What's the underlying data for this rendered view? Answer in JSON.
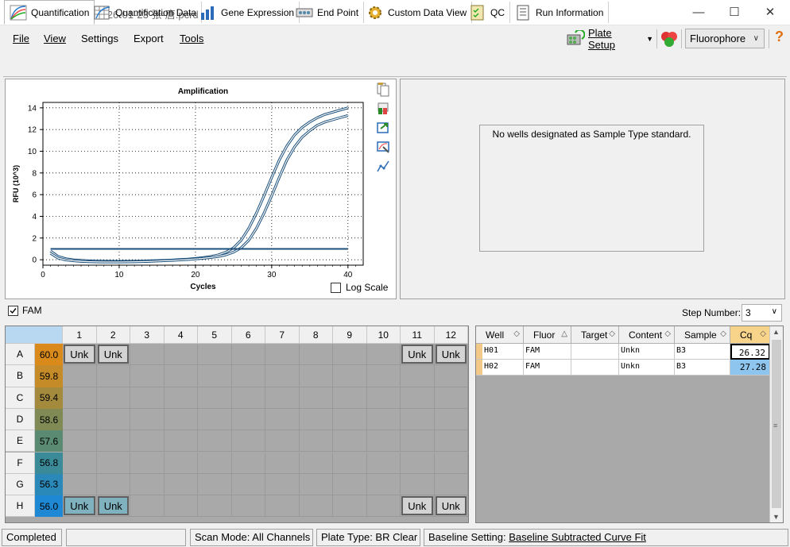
{
  "window": {
    "title": "Data Analysis - 2026-01-23 张-唐.pcrd"
  },
  "menu": {
    "file": "File",
    "view": "View",
    "settings": "Settings",
    "export": "Export",
    "tools": "Tools",
    "plate_setup": "Plate Setup",
    "fluorophore": "Fluorophore"
  },
  "tabs": [
    "Quantification",
    "Quantification Data",
    "Gene Expression",
    "End Point",
    "Custom Data View",
    "QC",
    "Run Information"
  ],
  "chart_data": {
    "type": "line",
    "title": "Amplification",
    "xlabel": "Cycles",
    "ylabel": "RFU (10^3)",
    "xlim": [
      0,
      42
    ],
    "ylim": [
      -0.5,
      14.5
    ],
    "xticks": [
      0,
      10,
      20,
      30,
      40
    ],
    "yticks": [
      0,
      2,
      4,
      6,
      8,
      10,
      12,
      14
    ],
    "grid": true,
    "threshold": 1.0,
    "series": [
      {
        "x": [
          1,
          2,
          3,
          4,
          5,
          6,
          7,
          8,
          9,
          10,
          11,
          12,
          13,
          14,
          15,
          16,
          17,
          18,
          19,
          20,
          21,
          22,
          23,
          24,
          25,
          26,
          27,
          28,
          29,
          30,
          31,
          32,
          33,
          34,
          35,
          36,
          37,
          38,
          39,
          40
        ],
        "y": [
          0.8,
          0.3,
          0.1,
          0.0,
          -0.05,
          -0.1,
          -0.12,
          -0.13,
          -0.14,
          -0.14,
          -0.14,
          -0.13,
          -0.12,
          -0.1,
          -0.08,
          -0.05,
          -0.02,
          0.02,
          0.06,
          0.12,
          0.2,
          0.3,
          0.45,
          0.7,
          1.1,
          1.8,
          2.9,
          4.3,
          5.9,
          7.6,
          9.2,
          10.5,
          11.5,
          12.2,
          12.7,
          13.1,
          13.4,
          13.6,
          13.8,
          14.0
        ]
      },
      {
        "x": [
          1,
          2,
          3,
          4,
          5,
          6,
          7,
          8,
          9,
          10,
          11,
          12,
          13,
          14,
          15,
          16,
          17,
          18,
          19,
          20,
          21,
          22,
          23,
          24,
          25,
          26,
          27,
          28,
          29,
          30,
          31,
          32,
          33,
          34,
          35,
          36,
          37,
          38,
          39,
          40
        ],
        "y": [
          0.6,
          0.15,
          -0.02,
          -0.1,
          -0.15,
          -0.18,
          -0.2,
          -0.21,
          -0.21,
          -0.21,
          -0.2,
          -0.19,
          -0.17,
          -0.15,
          -0.12,
          -0.09,
          -0.06,
          -0.02,
          0.02,
          0.07,
          0.13,
          0.2,
          0.3,
          0.45,
          0.7,
          1.1,
          1.8,
          2.9,
          4.3,
          5.9,
          7.6,
          9.2,
          10.4,
          11.3,
          11.9,
          12.4,
          12.7,
          12.9,
          13.1,
          13.3
        ]
      }
    ],
    "log_scale_label": "Log Scale",
    "log_scale_checked": false
  },
  "std_curve_message": "No wells designated as Sample Type standard.",
  "fam_label": "FAM",
  "fam_checked": true,
  "step_number_label": "Step Number:",
  "step_number_value": "3",
  "plate": {
    "columns": [
      "1",
      "2",
      "3",
      "4",
      "5",
      "6",
      "7",
      "8",
      "9",
      "10",
      "11",
      "12"
    ],
    "rows": [
      {
        "label": "A",
        "temp": "60.0",
        "color": "#d98a1a"
      },
      {
        "label": "B",
        "temp": "59.8",
        "color": "#c48b28"
      },
      {
        "label": "C",
        "temp": "59.4",
        "color": "#a38a3c"
      },
      {
        "label": "D",
        "temp": "58.6",
        "color": "#7f8a55"
      },
      {
        "label": "E",
        "temp": "57.6",
        "color": "#5a8b72"
      },
      {
        "label": "F",
        "temp": "56.8",
        "color": "#3a8a98"
      },
      {
        "label": "G",
        "temp": "56.3",
        "color": "#2a89b8"
      },
      {
        "label": "H",
        "temp": "56.0",
        "color": "#1e88d4"
      }
    ],
    "wells": [
      {
        "row": 0,
        "col": 0,
        "text": "Unk"
      },
      {
        "row": 0,
        "col": 1,
        "text": "Unk"
      },
      {
        "row": 0,
        "col": 10,
        "text": "Unk"
      },
      {
        "row": 0,
        "col": 11,
        "text": "Unk"
      },
      {
        "row": 7,
        "col": 0,
        "text": "Unk",
        "highlight": true
      },
      {
        "row": 7,
        "col": 1,
        "text": "Unk",
        "highlight": true
      },
      {
        "row": 7,
        "col": 10,
        "text": "Unk"
      },
      {
        "row": 7,
        "col": 11,
        "text": "Unk"
      }
    ]
  },
  "table": {
    "headers": [
      "Well",
      "Fluor",
      "Target",
      "Content",
      "Sample",
      "Cq"
    ],
    "rows": [
      [
        "H01",
        "FAM",
        "",
        "Unkn",
        "B3",
        "26.32"
      ],
      [
        "H02",
        "FAM",
        "",
        "Unkn",
        "B3",
        "27.28"
      ]
    ]
  },
  "status": {
    "completed": "Completed",
    "scan_mode": "Scan Mode: All Channels",
    "plate_type": "Plate Type: BR Clear",
    "baseline_prefix": "Baseline Setting: ",
    "baseline_value": "Baseline Subtracted Curve Fit"
  }
}
